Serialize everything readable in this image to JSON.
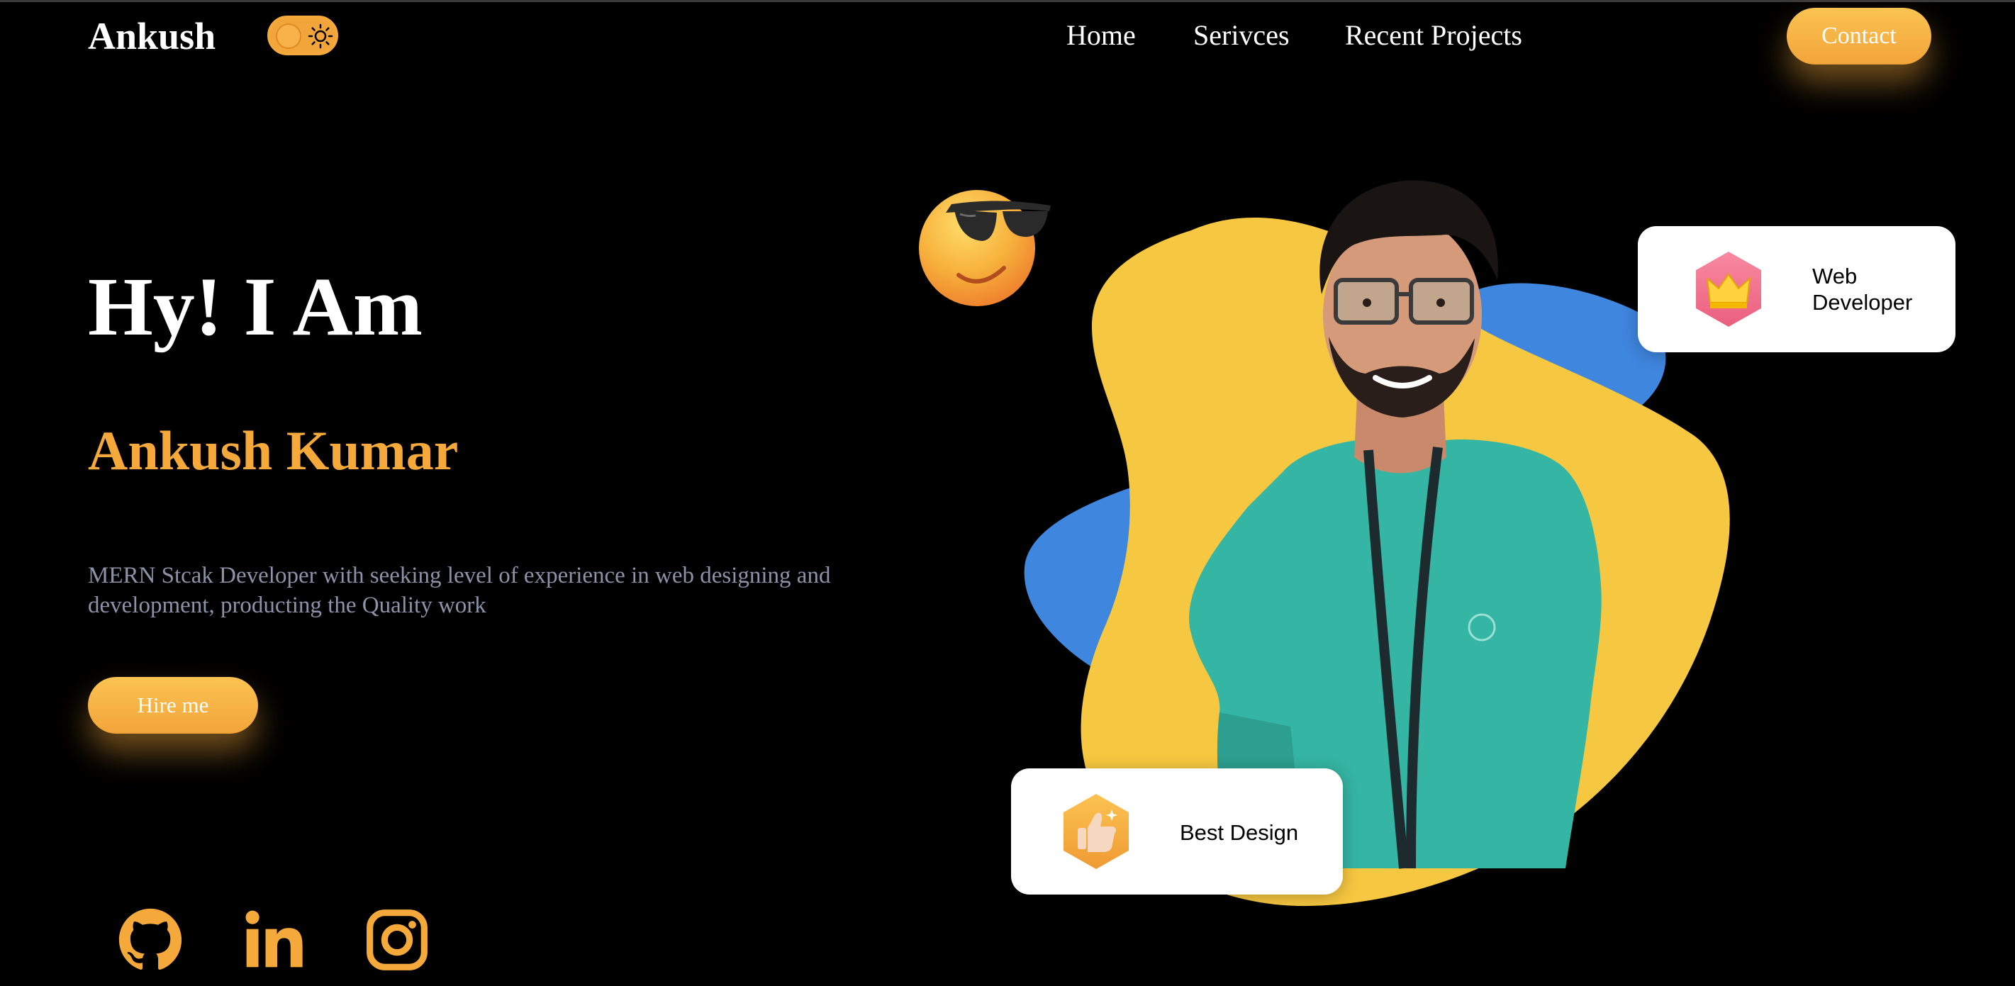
{
  "header": {
    "logo": "Ankush",
    "theme_toggle": {
      "state": "dark",
      "icon": "sun-icon"
    },
    "nav": [
      "Home",
      "Serivces",
      "Recent Projects"
    ],
    "contact_label": "Contact"
  },
  "hero": {
    "greeting": "Hy! I Am",
    "name": "Ankush Kumar",
    "description": "MERN Stcak Developer with seeking level of experience in web designing and development, producting the Quality work",
    "cta_label": "Hire me"
  },
  "social": [
    {
      "name": "github-icon"
    },
    {
      "name": "linkedin-icon"
    },
    {
      "name": "instagram-icon"
    }
  ],
  "cards": {
    "web": {
      "icon": "crown-icon",
      "label": "Web Developer"
    },
    "design": {
      "icon": "thumbs-up-icon",
      "label": "Best Design"
    }
  },
  "colors": {
    "accent": "#f5a93a",
    "blob_yellow": "#f6c740",
    "blob_blue": "#3f86df",
    "background": "#000000",
    "muted_text": "#8c93a8"
  }
}
